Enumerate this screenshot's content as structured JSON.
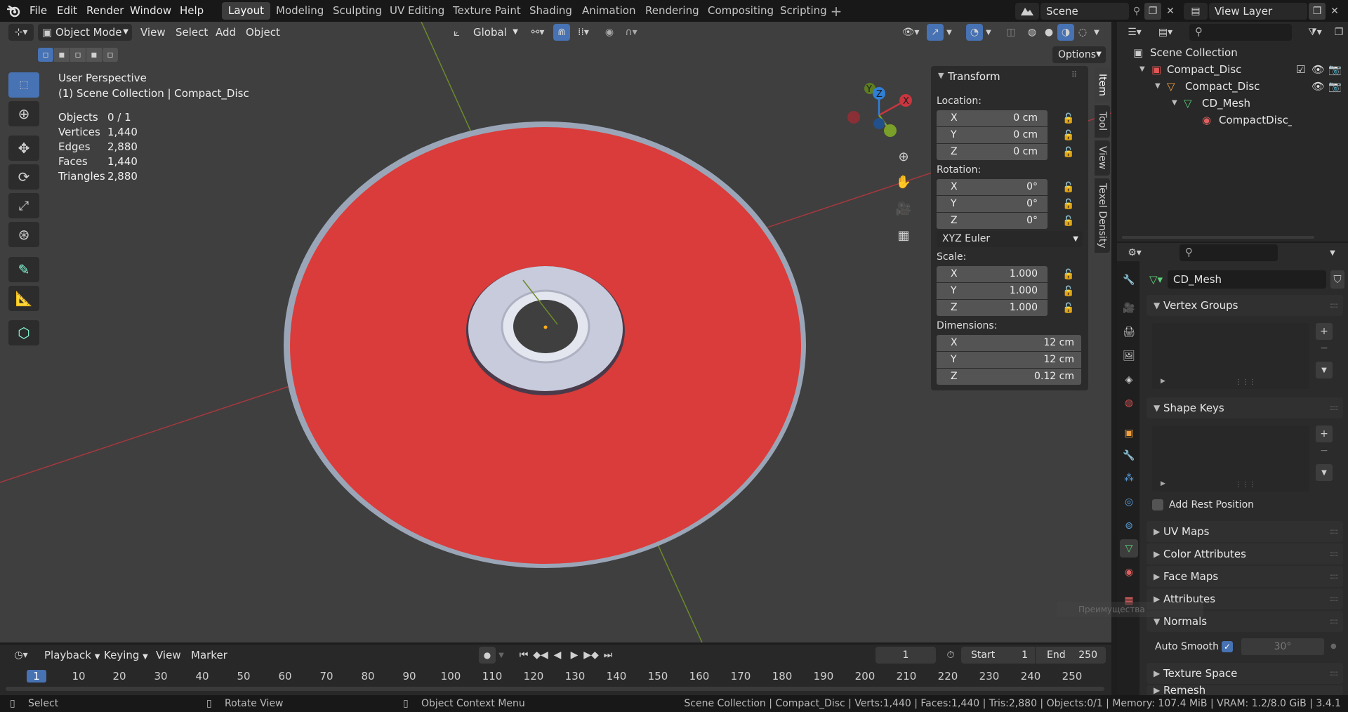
{
  "app": {
    "menus": [
      "File",
      "Edit",
      "Render",
      "Window",
      "Help"
    ],
    "workspaces": [
      "Layout",
      "Modeling",
      "Sculpting",
      "UV Editing",
      "Texture Paint",
      "Shading",
      "Animation",
      "Rendering",
      "Compositing",
      "Scripting"
    ],
    "scene": "Scene",
    "view_layer": "View Layer"
  },
  "viewport_header": {
    "mode": "Object Mode",
    "menus": [
      "View",
      "Select",
      "Add",
      "Object"
    ],
    "orientation": "Global",
    "options": "Options"
  },
  "overlay": {
    "perspective": "User Perspective",
    "collection_line": "(1) Scene Collection | Compact_Disc",
    "stats": [
      {
        "label": "Objects",
        "value": "0 / 1"
      },
      {
        "label": "Vertices",
        "value": "1,440"
      },
      {
        "label": "Edges",
        "value": "2,880"
      },
      {
        "label": "Faces",
        "value": "1,440"
      },
      {
        "label": "Triangles",
        "value": "2,880"
      }
    ]
  },
  "gizmo": {
    "x": "X",
    "y": "Y",
    "z": "Z"
  },
  "transform": {
    "title": "Transform",
    "location_label": "Location:",
    "location": [
      {
        "axis": "X",
        "value": "0 cm"
      },
      {
        "axis": "Y",
        "value": "0 cm"
      },
      {
        "axis": "Z",
        "value": "0 cm"
      }
    ],
    "rotation_label": "Rotation:",
    "rotation": [
      {
        "axis": "X",
        "value": "0°"
      },
      {
        "axis": "Y",
        "value": "0°"
      },
      {
        "axis": "Z",
        "value": "0°"
      }
    ],
    "rotation_mode": "XYZ Euler",
    "scale_label": "Scale:",
    "scale": [
      {
        "axis": "X",
        "value": "1.000"
      },
      {
        "axis": "Y",
        "value": "1.000"
      },
      {
        "axis": "Z",
        "value": "1.000"
      }
    ],
    "dimensions_label": "Dimensions:",
    "dimensions": [
      {
        "axis": "X",
        "value": "12 cm"
      },
      {
        "axis": "Y",
        "value": "12 cm"
      },
      {
        "axis": "Z",
        "value": "0.12 cm"
      }
    ]
  },
  "sidetabs": [
    "Item",
    "Tool",
    "View",
    "Texel Density"
  ],
  "outliner": {
    "rows": [
      "Scene Collection",
      "Compact_Disc",
      "Compact_Disc",
      "CD_Mesh",
      "CompactDisc_m"
    ]
  },
  "properties": {
    "mesh_name": "CD_Mesh",
    "sections": {
      "vertex_groups": "Vertex Groups",
      "shape_keys": "Shape Keys",
      "add_rest": "Add Rest Position",
      "uv_maps": "UV Maps",
      "color_attributes": "Color Attributes",
      "face_maps": "Face Maps",
      "attributes": "Attributes",
      "normals": "Normals",
      "auto_smooth": "Auto Smooth",
      "auto_smooth_angle": "30°",
      "texture_space": "Texture Space",
      "remesh": "Remesh"
    },
    "tooltip": "Преимущества"
  },
  "timeline": {
    "menus": [
      "Playback",
      "Keying",
      "View",
      "Marker"
    ],
    "current_frame": "1",
    "start_label": "Start",
    "start": "1",
    "end_label": "End",
    "end": "250",
    "ticks": [
      "1",
      "10",
      "20",
      "30",
      "40",
      "50",
      "60",
      "70",
      "80",
      "90",
      "100",
      "110",
      "120",
      "130",
      "140",
      "150",
      "160",
      "170",
      "180",
      "190",
      "200",
      "210",
      "220",
      "230",
      "240",
      "250"
    ]
  },
  "status": {
    "select": "Select",
    "rotate": "Rotate View",
    "context": "Object Context Menu",
    "info": "Scene Collection | Compact_Disc | Verts:1,440 | Faces:1,440 | Tris:2,880 | Objects:0/1 | Memory: 107.4 MiB | VRAM: 1.2/8.0 GiB | 3.4.1"
  },
  "colors": {
    "disc_red": "#d93c3a",
    "accent_blue": "#4772b3",
    "x_axis": "#c8363f",
    "y_axis": "#7aa02a",
    "z_axis": "#2f7fd6"
  }
}
